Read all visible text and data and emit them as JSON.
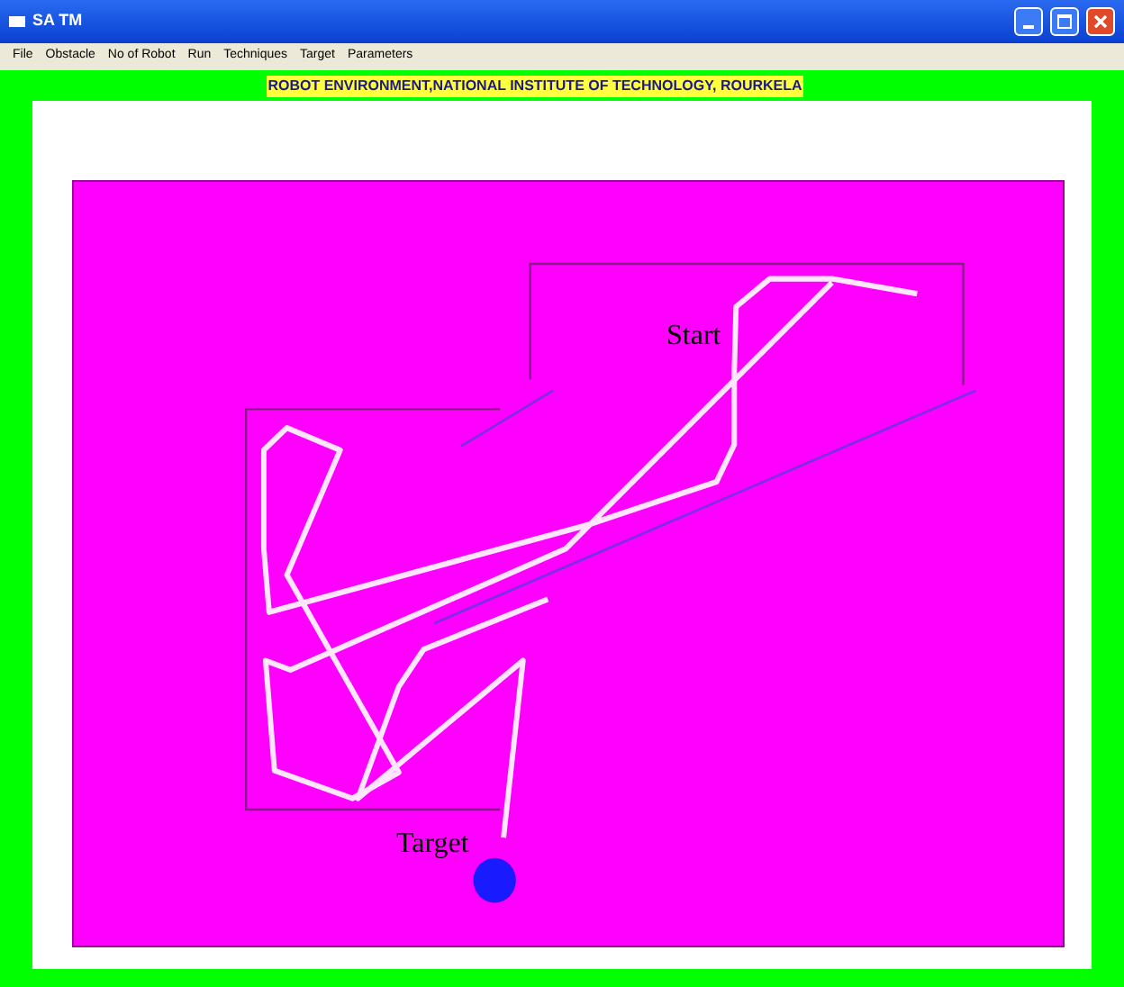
{
  "window": {
    "title": "SA TM"
  },
  "menu": [
    "File",
    "Obstacle",
    "No of Robot",
    "Run",
    "Techniques",
    "Target",
    "Parameters"
  ],
  "banner": "ROBOT ENVIRONMENT,NATIONAL INSTITUTE OF TECHNOLOGY, ROURKELA",
  "canvas": {
    "labels": [
      {
        "kind": "start",
        "text": "Start"
      },
      {
        "kind": "target",
        "text": "Target"
      }
    ]
  }
}
